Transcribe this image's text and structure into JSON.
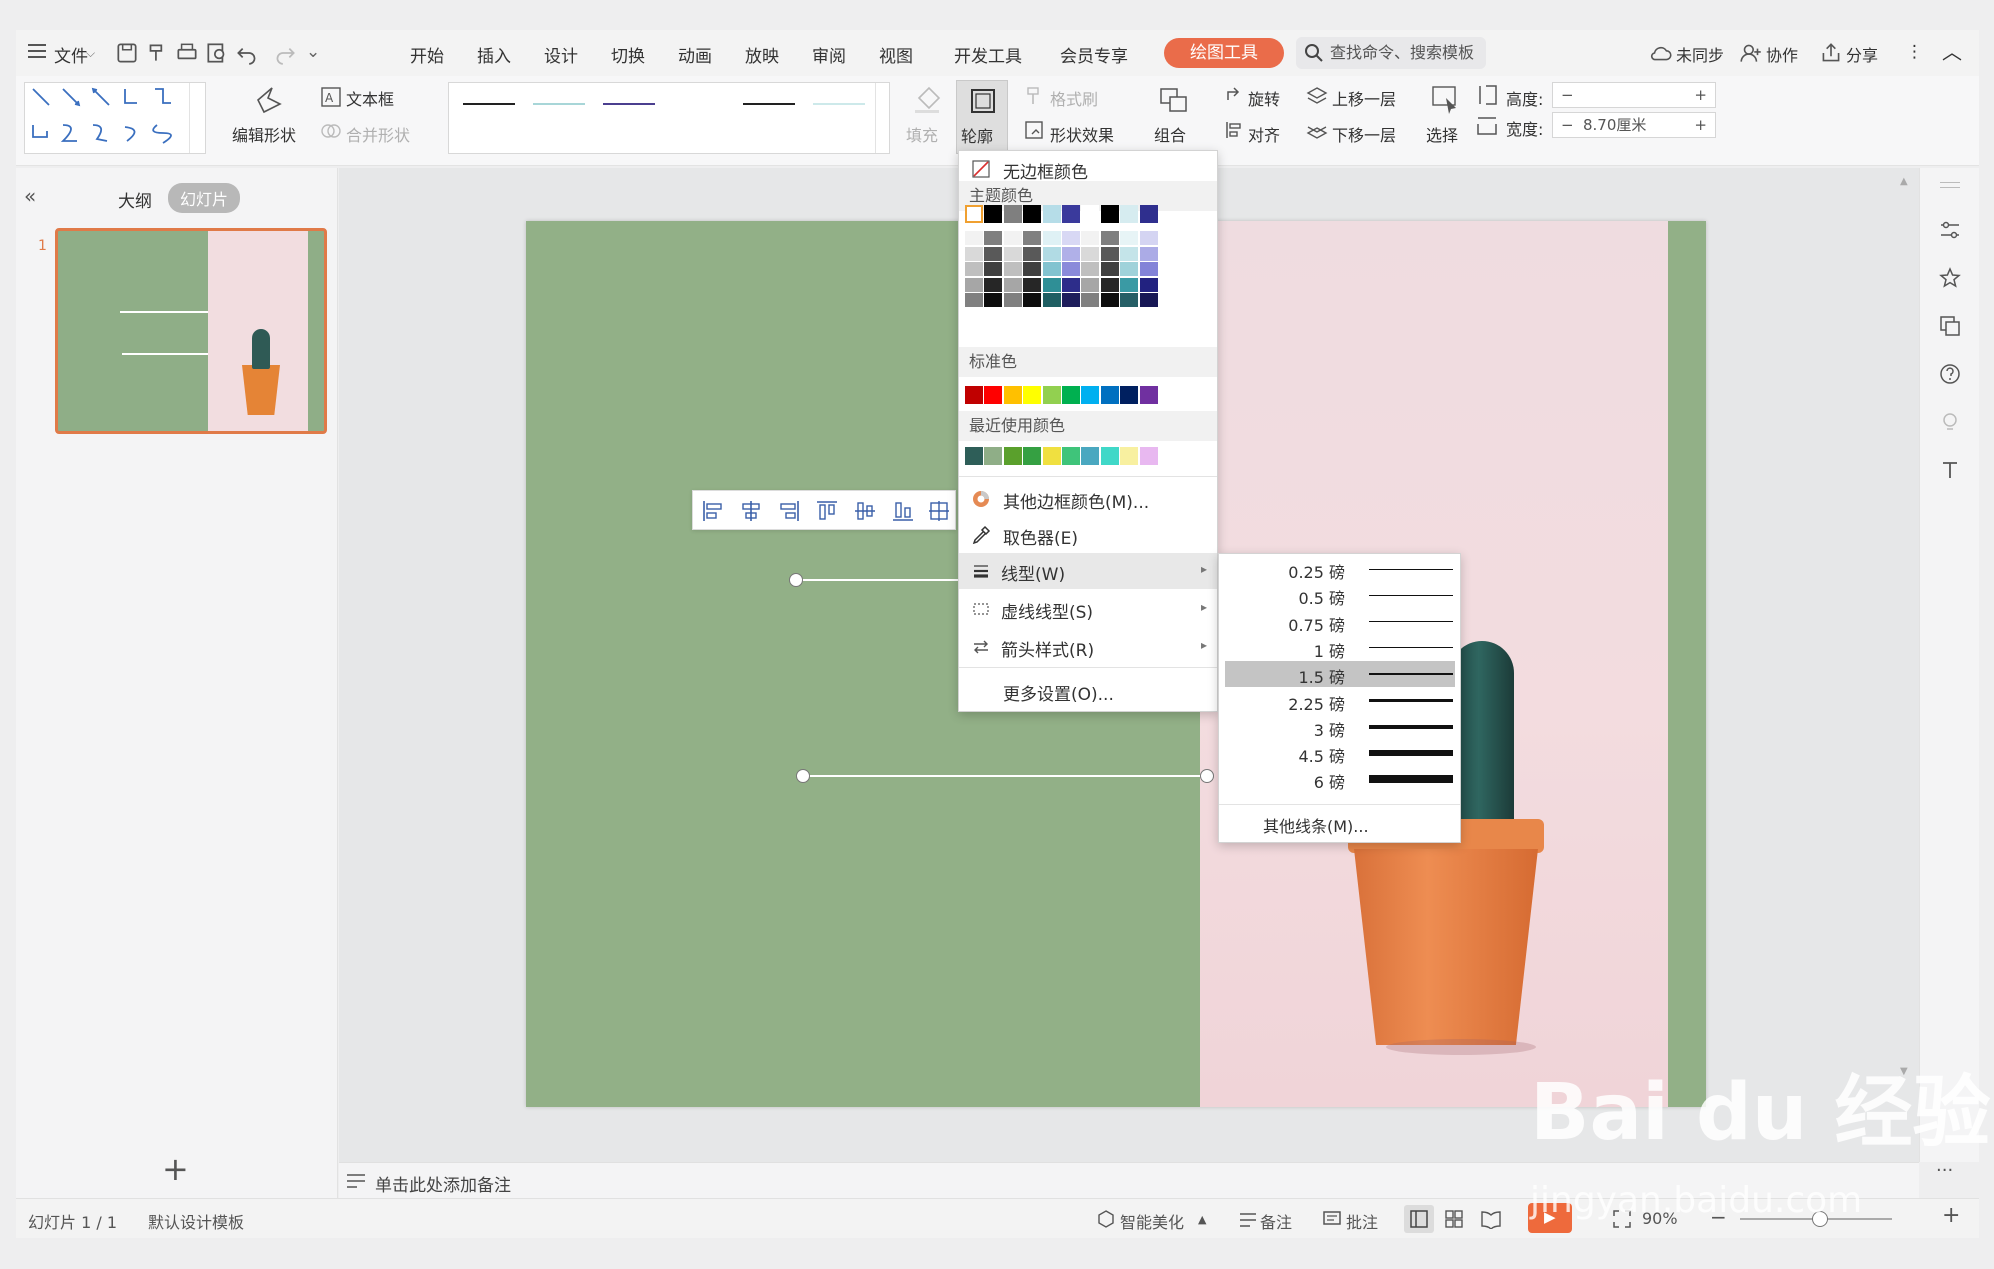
{
  "menubar": {
    "file_label": "文件",
    "tabs": [
      "开始",
      "插入",
      "设计",
      "切换",
      "动画",
      "放映",
      "审阅",
      "视图",
      "开发工具",
      "会员专享"
    ],
    "active_tab": "绘图工具",
    "search_placeholder": "查找命令、搜索模板",
    "right": {
      "sync": "未同步",
      "collab": "协作",
      "share": "分享"
    }
  },
  "ribbon": {
    "edit_shape": "编辑形状",
    "text_box": "文本框",
    "merge_shape": "合并形状",
    "fill": "填充",
    "outline": "轮廓",
    "format_painter": "格式刷",
    "shape_effect": "形状效果",
    "group": "组合",
    "rotate": "旋转",
    "align": "对齐",
    "bring_forward": "上移一层",
    "send_backward": "下移一层",
    "select": "选择",
    "height_label": "高度:",
    "height_value": "",
    "width_label": "宽度:",
    "width_value": "8.70厘米",
    "minus": "−",
    "plus": "+"
  },
  "leftpane": {
    "outline_tab": "大纲",
    "slides_tab": "幻灯片",
    "slide_number": "1",
    "add_symbol": "+"
  },
  "outline_menu": {
    "no_border": "无边框颜色",
    "theme_colors": "主题颜色",
    "standard_colors": "标准色",
    "recent_colors": "最近使用颜色",
    "other_colors": "其他边框颜色(M)...",
    "eyedropper": "取色器(E)",
    "line_type": "线型(W)",
    "dash_type": "虚线线型(S)",
    "arrow_style": "箭头样式(R)",
    "more_settings": "更多设置(O)...",
    "theme_top_row": [
      "#ffffff",
      "#000000",
      "#7f7f7f",
      "#000000",
      "#b6dde8",
      "#3a3a9c",
      "#ffffff",
      "#000000",
      "#d6ecf0",
      "#2f2f8e"
    ],
    "standard_row": [
      "#c00000",
      "#ff0000",
      "#ffc000",
      "#ffff00",
      "#92d050",
      "#00b050",
      "#00b0f0",
      "#0070c0",
      "#002060",
      "#7030a0"
    ],
    "recent_row": [
      "#2e5e58",
      "#8fae87",
      "#5aa02c",
      "#35a042",
      "#f0e040",
      "#3fc47a",
      "#4aa8c0",
      "#40d8c8",
      "#f8f0a0",
      "#e8b8f0"
    ]
  },
  "weight_menu": {
    "weights": [
      {
        "label": "0.25 磅",
        "pt": 0.25
      },
      {
        "label": "0.5 磅",
        "pt": 0.5
      },
      {
        "label": "0.75 磅",
        "pt": 0.75
      },
      {
        "label": "1 磅",
        "pt": 1
      },
      {
        "label": "1.5 磅",
        "pt": 1.5
      },
      {
        "label": "2.25 磅",
        "pt": 2.25
      },
      {
        "label": "3 磅",
        "pt": 3
      },
      {
        "label": "4.5 磅",
        "pt": 4.5
      },
      {
        "label": "6 磅",
        "pt": 6
      }
    ],
    "selected": "1.5 磅",
    "other_lines": "其他线条(M)..."
  },
  "notes": {
    "placeholder": "单击此处添加备注"
  },
  "status": {
    "slide_counter": "幻灯片 1 / 1",
    "template": "默认设计模板",
    "beautify": "智能美化",
    "notes_btn": "备注",
    "comments_btn": "批注",
    "zoom": "90%"
  },
  "watermark": {
    "brand": "Bai du 经验",
    "url": "jingyan.baidu.com"
  }
}
